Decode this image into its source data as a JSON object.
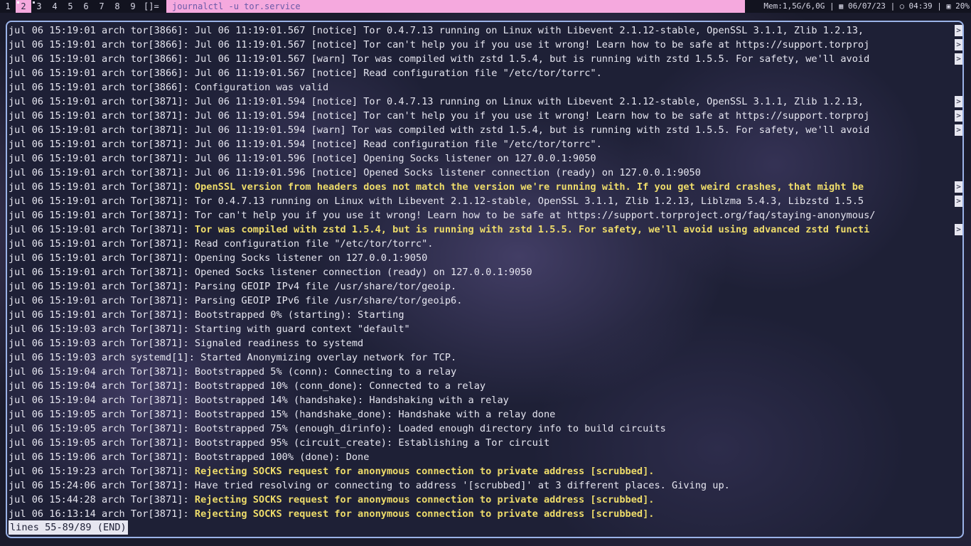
{
  "topbar": {
    "tags": [
      {
        "label": "1",
        "active": false,
        "occupied": false
      },
      {
        "label": "2",
        "active": true,
        "occupied": true
      },
      {
        "label": "3",
        "active": false,
        "occupied": true
      },
      {
        "label": "4",
        "active": false,
        "occupied": false
      },
      {
        "label": "5",
        "active": false,
        "occupied": false
      },
      {
        "label": "6",
        "active": false,
        "occupied": false
      },
      {
        "label": "7",
        "active": false,
        "occupied": false
      },
      {
        "label": "8",
        "active": false,
        "occupied": false
      },
      {
        "label": "9",
        "active": false,
        "occupied": false
      }
    ],
    "layout_symbol": "[]=",
    "window_title": "journalctl -u tor.service",
    "mem": "Mem:1,5G/6,0G",
    "date_icon": "calendar-icon",
    "date": "06/07/23",
    "clock_icon": "clock-icon",
    "time": "04:39",
    "battery_icon": "battery-icon",
    "battery": "20%",
    "separator": "|"
  },
  "terminal": {
    "lines": [
      {
        "prefix": "jul 06 15:19:01 arch tor[3866]: ",
        "msg": "Jul 06 11:19:01.567 [notice] Tor 0.4.7.13 running on Linux with Libevent 2.1.12-stable, OpenSSL 3.1.1, Zlib 1.2.13,",
        "style": "norm",
        "truncated": true
      },
      {
        "prefix": "jul 06 15:19:01 arch tor[3866]: ",
        "msg": "Jul 06 11:19:01.567 [notice] Tor can't help you if you use it wrong! Learn how to be safe at https://support.torproj",
        "style": "norm",
        "truncated": true
      },
      {
        "prefix": "jul 06 15:19:01 arch tor[3866]: ",
        "msg": "Jul 06 11:19:01.567 [warn] Tor was compiled with zstd 1.5.4, but is running with zstd 1.5.5. For safety, we'll avoid",
        "style": "norm",
        "truncated": true
      },
      {
        "prefix": "jul 06 15:19:01 arch tor[3866]: ",
        "msg": "Jul 06 11:19:01.567 [notice] Read configuration file \"/etc/tor/torrc\".",
        "style": "norm",
        "truncated": false
      },
      {
        "prefix": "jul 06 15:19:01 arch tor[3866]: ",
        "msg": "Configuration was valid",
        "style": "norm",
        "truncated": false
      },
      {
        "prefix": "jul 06 15:19:01 arch tor[3871]: ",
        "msg": "Jul 06 11:19:01.594 [notice] Tor 0.4.7.13 running on Linux with Libevent 2.1.12-stable, OpenSSL 3.1.1, Zlib 1.2.13,",
        "style": "norm",
        "truncated": true
      },
      {
        "prefix": "jul 06 15:19:01 arch tor[3871]: ",
        "msg": "Jul 06 11:19:01.594 [notice] Tor can't help you if you use it wrong! Learn how to be safe at https://support.torproj",
        "style": "norm",
        "truncated": true
      },
      {
        "prefix": "jul 06 15:19:01 arch tor[3871]: ",
        "msg": "Jul 06 11:19:01.594 [warn] Tor was compiled with zstd 1.5.4, but is running with zstd 1.5.5. For safety, we'll avoid",
        "style": "norm",
        "truncated": true
      },
      {
        "prefix": "jul 06 15:19:01 arch tor[3871]: ",
        "msg": "Jul 06 11:19:01.594 [notice] Read configuration file \"/etc/tor/torrc\".",
        "style": "norm",
        "truncated": false
      },
      {
        "prefix": "jul 06 15:19:01 arch tor[3871]: ",
        "msg": "Jul 06 11:19:01.596 [notice] Opening Socks listener on 127.0.0.1:9050",
        "style": "norm",
        "truncated": false
      },
      {
        "prefix": "jul 06 15:19:01 arch tor[3871]: ",
        "msg": "Jul 06 11:19:01.596 [notice] Opened Socks listener connection (ready) on 127.0.0.1:9050",
        "style": "norm",
        "truncated": false
      },
      {
        "prefix": "jul 06 15:19:01 arch Tor[3871]: ",
        "msg": "OpenSSL version from headers does not match the version we're running with. If you get weird crashes, that might be",
        "style": "warn",
        "truncated": true
      },
      {
        "prefix": "jul 06 15:19:01 arch Tor[3871]: ",
        "msg": "Tor 0.4.7.13 running on Linux with Libevent 2.1.12-stable, OpenSSL 3.1.1, Zlib 1.2.13, Liblzma 5.4.3, Libzstd 1.5.5",
        "style": "norm",
        "truncated": true
      },
      {
        "prefix": "jul 06 15:19:01 arch Tor[3871]: ",
        "msg": "Tor can't help you if you use it wrong! Learn how to be safe at https://support.torproject.org/faq/staying-anonymous/",
        "style": "norm",
        "truncated": false
      },
      {
        "prefix": "jul 06 15:19:01 arch Tor[3871]: ",
        "msg": "Tor was compiled with zstd 1.5.4, but is running with zstd 1.5.5. For safety, we'll avoid using advanced zstd functi",
        "style": "warn",
        "truncated": true
      },
      {
        "prefix": "jul 06 15:19:01 arch Tor[3871]: ",
        "msg": "Read configuration file \"/etc/tor/torrc\".",
        "style": "norm",
        "truncated": false
      },
      {
        "prefix": "jul 06 15:19:01 arch Tor[3871]: ",
        "msg": "Opening Socks listener on 127.0.0.1:9050",
        "style": "norm",
        "truncated": false
      },
      {
        "prefix": "jul 06 15:19:01 arch Tor[3871]: ",
        "msg": "Opened Socks listener connection (ready) on 127.0.0.1:9050",
        "style": "norm",
        "truncated": false
      },
      {
        "prefix": "jul 06 15:19:01 arch Tor[3871]: ",
        "msg": "Parsing GEOIP IPv4 file /usr/share/tor/geoip.",
        "style": "norm",
        "truncated": false
      },
      {
        "prefix": "jul 06 15:19:01 arch Tor[3871]: ",
        "msg": "Parsing GEOIP IPv6 file /usr/share/tor/geoip6.",
        "style": "norm",
        "truncated": false
      },
      {
        "prefix": "jul 06 15:19:01 arch Tor[3871]: ",
        "msg": "Bootstrapped 0% (starting): Starting",
        "style": "norm",
        "truncated": false
      },
      {
        "prefix": "jul 06 15:19:03 arch Tor[3871]: ",
        "msg": "Starting with guard context \"default\"",
        "style": "norm",
        "truncated": false
      },
      {
        "prefix": "jul 06 15:19:03 arch Tor[3871]: ",
        "msg": "Signaled readiness to systemd",
        "style": "norm",
        "truncated": false
      },
      {
        "prefix": "jul 06 15:19:03 arch systemd[1]: ",
        "msg": "Started Anonymizing overlay network for TCP.",
        "style": "norm",
        "truncated": false
      },
      {
        "prefix": "jul 06 15:19:04 arch Tor[3871]: ",
        "msg": "Bootstrapped 5% (conn): Connecting to a relay",
        "style": "norm",
        "truncated": false
      },
      {
        "prefix": "jul 06 15:19:04 arch Tor[3871]: ",
        "msg": "Bootstrapped 10% (conn_done): Connected to a relay",
        "style": "norm",
        "truncated": false
      },
      {
        "prefix": "jul 06 15:19:04 arch Tor[3871]: ",
        "msg": "Bootstrapped 14% (handshake): Handshaking with a relay",
        "style": "norm",
        "truncated": false
      },
      {
        "prefix": "jul 06 15:19:05 arch Tor[3871]: ",
        "msg": "Bootstrapped 15% (handshake_done): Handshake with a relay done",
        "style": "norm",
        "truncated": false
      },
      {
        "prefix": "jul 06 15:19:05 arch Tor[3871]: ",
        "msg": "Bootstrapped 75% (enough_dirinfo): Loaded enough directory info to build circuits",
        "style": "norm",
        "truncated": false
      },
      {
        "prefix": "jul 06 15:19:05 arch Tor[3871]: ",
        "msg": "Bootstrapped 95% (circuit_create): Establishing a Tor circuit",
        "style": "norm",
        "truncated": false
      },
      {
        "prefix": "jul 06 15:19:06 arch Tor[3871]: ",
        "msg": "Bootstrapped 100% (done): Done",
        "style": "norm",
        "truncated": false
      },
      {
        "prefix": "jul 06 15:19:23 arch Tor[3871]: ",
        "msg": "Rejecting SOCKS request for anonymous connection to private address [scrubbed].",
        "style": "warn",
        "truncated": false
      },
      {
        "prefix": "jul 06 15:24:06 arch Tor[3871]: ",
        "msg": "Have tried resolving or connecting to address '[scrubbed]' at 3 different places. Giving up.",
        "style": "norm",
        "truncated": false
      },
      {
        "prefix": "jul 06 15:44:28 arch Tor[3871]: ",
        "msg": "Rejecting SOCKS request for anonymous connection to private address [scrubbed].",
        "style": "warn",
        "truncated": false
      },
      {
        "prefix": "jul 06 16:13:14 arch Tor[3871]: ",
        "msg": "Rejecting SOCKS request for anonymous connection to private address [scrubbed].",
        "style": "warn",
        "truncated": false
      }
    ],
    "truncation_marker": ">",
    "pager_status": "lines 55-89/89 (END)"
  },
  "colors": {
    "bar_accent": "#f5a9de",
    "warn_text": "#eedc6a",
    "normal_text": "#e6e6f0",
    "border": "#9bb3e8"
  }
}
